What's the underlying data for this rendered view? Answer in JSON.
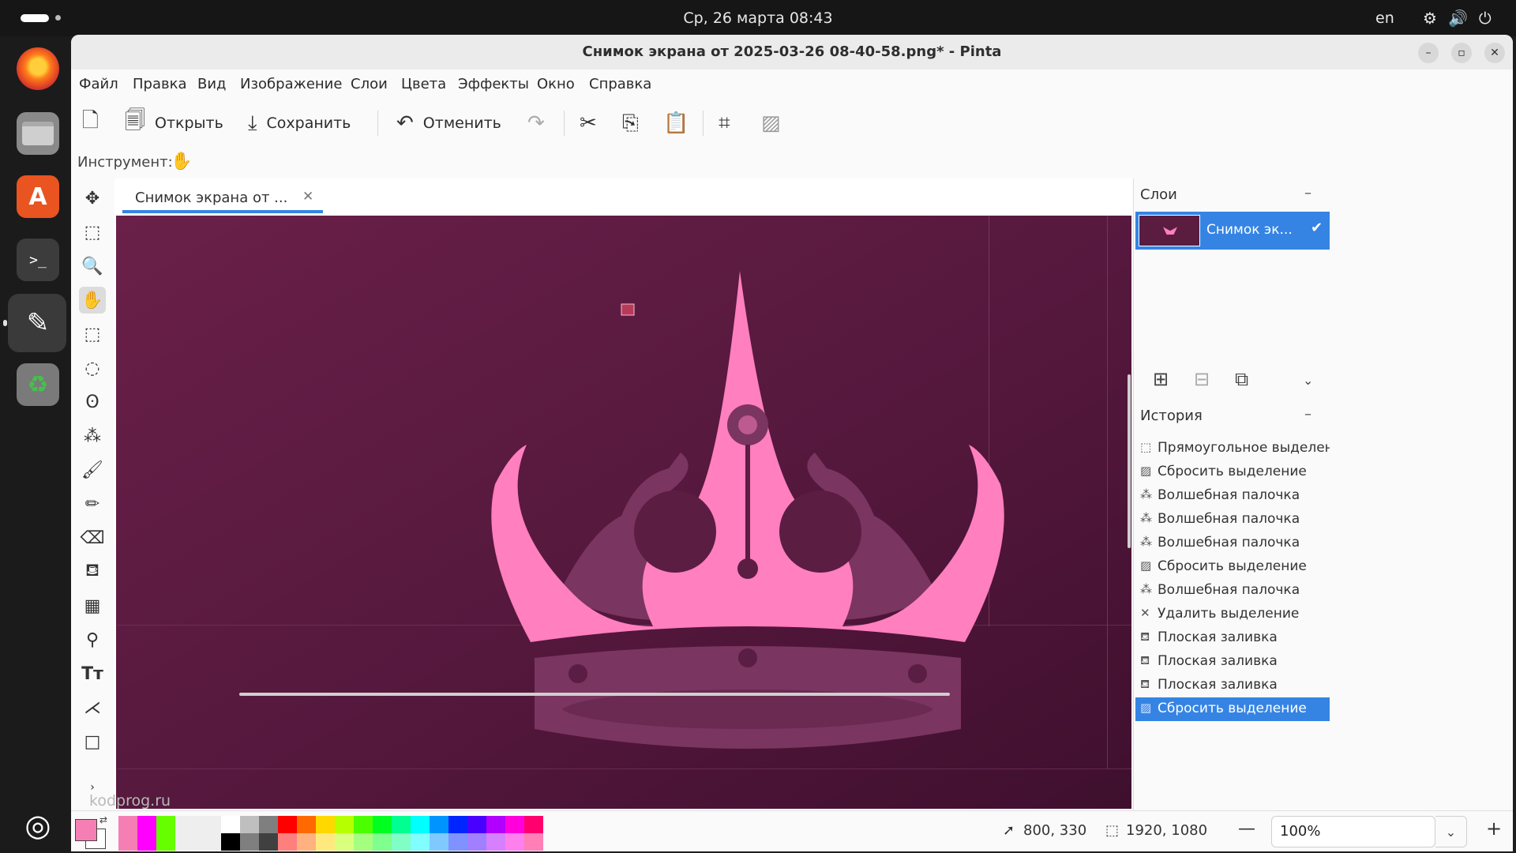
{
  "topbar": {
    "clock": "Ср, 26 марта  08:43",
    "lang": "en"
  },
  "dock": {
    "apps": [
      {
        "name": "firefox-icon",
        "color": "#e66000"
      },
      {
        "name": "files-icon",
        "color": "#7a7a7a"
      },
      {
        "name": "app-center-icon",
        "color": "#e95420"
      },
      {
        "name": "terminal-icon",
        "color": "#3a3a3a"
      },
      {
        "name": "pinta-icon",
        "color": "#444444"
      },
      {
        "name": "trash-icon",
        "color": "#6e6e6e"
      }
    ]
  },
  "window": {
    "title": "Снимок экрана от 2025-03-26 08-40-58.png* - Pinta"
  },
  "menu": [
    "Файл",
    "Правка",
    "Вид",
    "Изображение",
    "Слои",
    "Цвета",
    "Эффекты",
    "Окно",
    "Справка"
  ],
  "toolbar": {
    "open": "Открыть",
    "save": "Сохранить",
    "undo": "Отменить"
  },
  "toolrow": {
    "label": "Инструмент:"
  },
  "document": {
    "tab_title": "Снимок экрана от ..."
  },
  "layers": {
    "header": "Слои",
    "items": [
      {
        "name": "Снимок эк..."
      }
    ]
  },
  "history": {
    "header": "История",
    "items": [
      {
        "label": "Прямоугольное выделение",
        "icon": "rect-select-icon"
      },
      {
        "label": "Сбросить выделение",
        "icon": "deselect-icon"
      },
      {
        "label": "Волшебная палочка",
        "icon": "magic-wand-icon"
      },
      {
        "label": "Волшебная палочка",
        "icon": "magic-wand-icon"
      },
      {
        "label": "Волшебная палочка",
        "icon": "magic-wand-icon"
      },
      {
        "label": "Сбросить выделение",
        "icon": "deselect-icon"
      },
      {
        "label": "Волшебная палочка",
        "icon": "magic-wand-icon"
      },
      {
        "label": "Удалить выделение",
        "icon": "erase-selection-icon"
      },
      {
        "label": "Плоская заливка",
        "icon": "bucket-icon"
      },
      {
        "label": "Плоская заливка",
        "icon": "bucket-icon"
      },
      {
        "label": "Плоская заливка",
        "icon": "bucket-icon"
      },
      {
        "label": "Сбросить выделение",
        "icon": "deselect-icon"
      }
    ],
    "selected_index": 11
  },
  "status": {
    "cursor": "800, 330",
    "selection_size": "1920, 1080",
    "zoom": "100%",
    "watermark": "kodprog.ru"
  },
  "colors": {
    "primary": "#f57fb5",
    "secondary": "#ffffff",
    "accent": "#3584e4",
    "canvas_bg": "#5c1d43",
    "crown_fill": "#ff7fbf",
    "crown_shade": "#7a3560"
  },
  "palette": {
    "recent": [
      "#f57fb5",
      "#ff00ff",
      "#66ff00",
      "#eeeeee",
      "#eeeeee",
      "#eeeeee"
    ],
    "top": [
      "#ffffff",
      "#bfbfbf",
      "#7f7f7f",
      "#ff0000",
      "#ff6a00",
      "#ffd800",
      "#b6ff00",
      "#4cff00",
      "#00ff21",
      "#00ff90",
      "#00ffff",
      "#0094ff",
      "#0026ff",
      "#4800ff",
      "#b200ff",
      "#ff00dc",
      "#ff006e"
    ],
    "bottom": [
      "#000000",
      "#7f7f7f",
      "#404040",
      "#ff7f7f",
      "#ffb27f",
      "#ffe97f",
      "#daff7f",
      "#a5ff7f",
      "#7fff8e",
      "#7fffc5",
      "#7fffff",
      "#7fc9ff",
      "#7f92ff",
      "#a17fff",
      "#d67fff",
      "#ff7fed",
      "#ff7fb6"
    ]
  }
}
